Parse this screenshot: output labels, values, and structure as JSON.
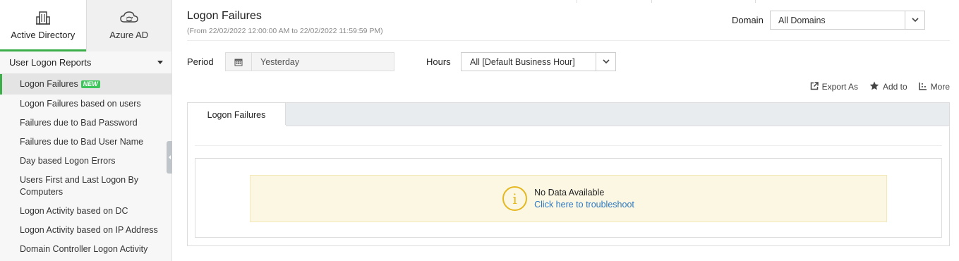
{
  "sidebar": {
    "tabs": [
      {
        "label": "Active Directory",
        "icon": "building-icon",
        "active": true
      },
      {
        "label": "Azure AD",
        "icon": "cloud-sync-icon",
        "active": false
      }
    ],
    "section_title": "User Logon Reports",
    "items": [
      {
        "label": "Logon Failures",
        "badge": "NEW",
        "active": true
      },
      {
        "label": "Logon Failures based on users"
      },
      {
        "label": "Failures due to Bad Password"
      },
      {
        "label": "Failures due to Bad User Name"
      },
      {
        "label": "Day based Logon Errors"
      },
      {
        "label": "Users First and Last Logon By Computers"
      },
      {
        "label": "Logon Activity based on DC"
      },
      {
        "label": "Logon Activity based on IP Address"
      },
      {
        "label": "Domain Controller Logon Activity"
      }
    ]
  },
  "header": {
    "title": "Logon Failures",
    "subtitle": "(From 22/02/2022 12:00:00 AM to 22/02/2022 11:59:59 PM)",
    "domain_label": "Domain",
    "domain_value": "All Domains"
  },
  "filters": {
    "period_label": "Period",
    "period_value": "Yesterday",
    "hours_label": "Hours",
    "hours_value": "All [Default Business Hour]"
  },
  "actions": {
    "export_label": "Export As",
    "add_label": "Add to",
    "more_label": "More"
  },
  "report": {
    "tab_label": "Logon Failures",
    "empty_title": "No Data Available",
    "empty_link": "Click here to troubleshoot"
  },
  "colors": {
    "accent": "#3cae49",
    "link": "#2a78c5",
    "warning": "#e5b820",
    "notice_bg": "#fbf7e3"
  }
}
